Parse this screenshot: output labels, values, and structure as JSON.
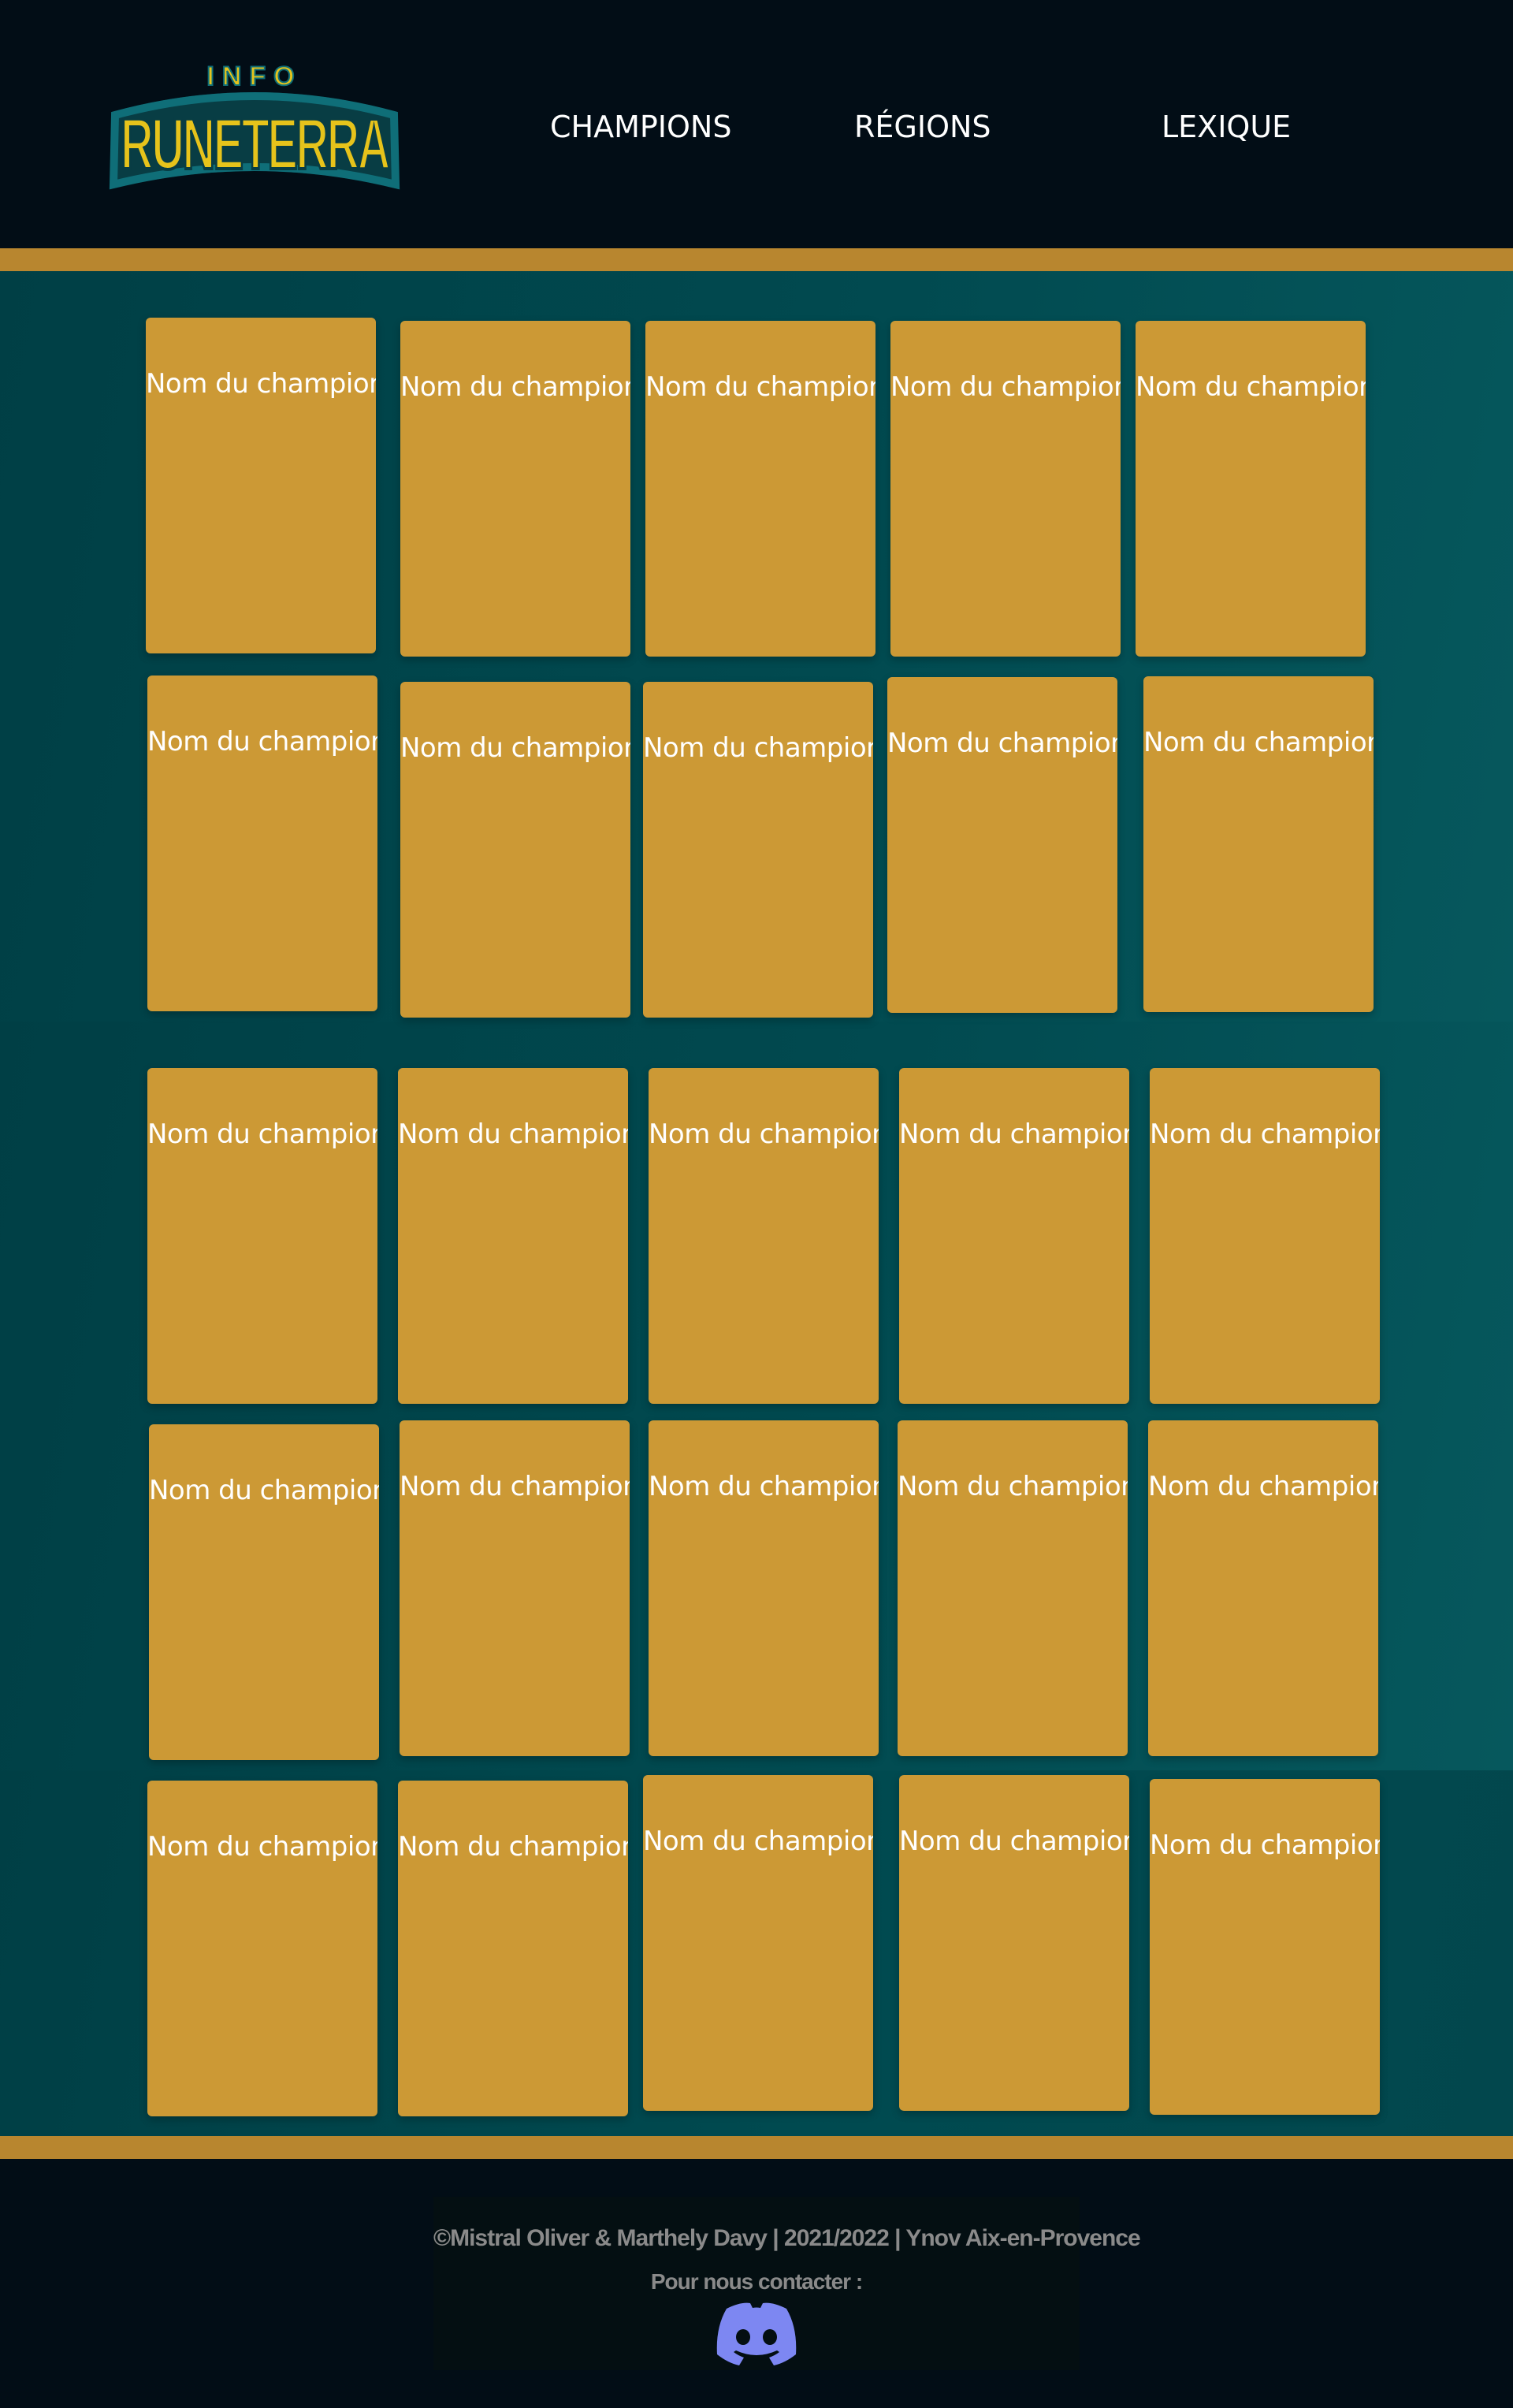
{
  "header": {
    "logo": {
      "small_text": "INFO",
      "big_text": "RUNETERRA",
      "colors": {
        "fill": "#e6c31b",
        "outline": "#0f6e78",
        "shadow": "#083d44"
      }
    },
    "nav": [
      {
        "label": "CHAMPIONS"
      },
      {
        "label": "RÉGIONS"
      },
      {
        "label": "LEXIQUE"
      }
    ]
  },
  "champions": [
    {
      "label": "Nom du champion"
    },
    {
      "label": "Nom du champion"
    },
    {
      "label": "Nom du champion"
    },
    {
      "label": "Nom du champion"
    },
    {
      "label": "Nom du champion"
    },
    {
      "label": "Nom du champion"
    },
    {
      "label": "Nom du champion"
    },
    {
      "label": "Nom du champion"
    },
    {
      "label": "Nom du champion"
    },
    {
      "label": "Nom du champion"
    },
    {
      "label": "Nom du champion"
    },
    {
      "label": "Nom du champion"
    },
    {
      "label": "Nom du champion"
    },
    {
      "label": "Nom du champion"
    },
    {
      "label": "Nom du champion"
    },
    {
      "label": "Nom du champion"
    },
    {
      "label": "Nom du champion"
    },
    {
      "label": "Nom du champion"
    },
    {
      "label": "Nom du champion"
    },
    {
      "label": "Nom du champion"
    },
    {
      "label": "Nom du champion"
    },
    {
      "label": "Nom du champion"
    },
    {
      "label": "Nom du champion"
    },
    {
      "label": "Nom du champion"
    },
    {
      "label": "Nom du champion"
    }
  ],
  "footer": {
    "credit": "©Mistral Oliver & Marthely Davy | 2021/2022 | Ynov Aix-en-Provence",
    "contact": "Pour nous contacter :",
    "discord_icon": "discord-icon",
    "discord_color": "#7d87f2"
  },
  "colors": {
    "header_bg": "#020d16",
    "gold_band": "#b8862f",
    "main_teal": "#014a50",
    "card": "#cc9935"
  }
}
